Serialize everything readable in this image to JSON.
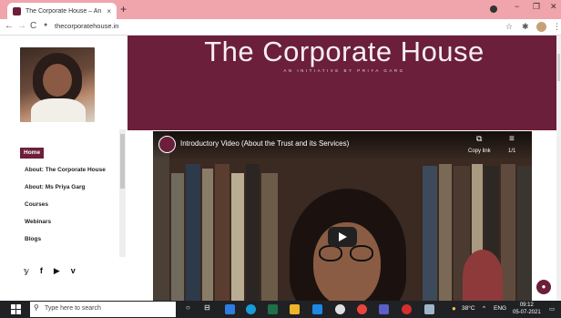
{
  "browser": {
    "tab_title": "The Corporate House – An Initia",
    "tab_close": "×",
    "new_tab": "+",
    "url": "thecorporatehouse.in",
    "nav_back": "←",
    "nav_forward": "→",
    "nav_reload": "C",
    "lock_icon": "🔒",
    "window_controls": [
      "−",
      "❐",
      "✕"
    ]
  },
  "header": {
    "title": "The Corporate House",
    "subtitle": "AN INITIATIVE BY PRIYA GARG"
  },
  "sidebar": {
    "menu": [
      {
        "label": "Home",
        "active": true
      },
      {
        "label": "About: The Corporate House",
        "active": false
      },
      {
        "label": "About: Ms Priya Garg",
        "active": false
      },
      {
        "label": "Courses",
        "active": false
      },
      {
        "label": "Webinars",
        "active": false
      },
      {
        "label": "Blogs",
        "active": false
      }
    ],
    "social": [
      "𝕪",
      "f",
      "▶",
      "v"
    ]
  },
  "video": {
    "title": "Introductory Video (About the Trust and its Services)",
    "copy_link": "Copy link",
    "playlist_count": "1/1"
  },
  "taskbar": {
    "search_placeholder": "Type here to search",
    "weather": "38°C",
    "lang": "ENG",
    "time": "09:12",
    "date": "05-07-2021"
  },
  "colors": {
    "brand": "#6b1f3a",
    "tabstrip": "#f0a4ab",
    "taskbar": "#202124"
  }
}
